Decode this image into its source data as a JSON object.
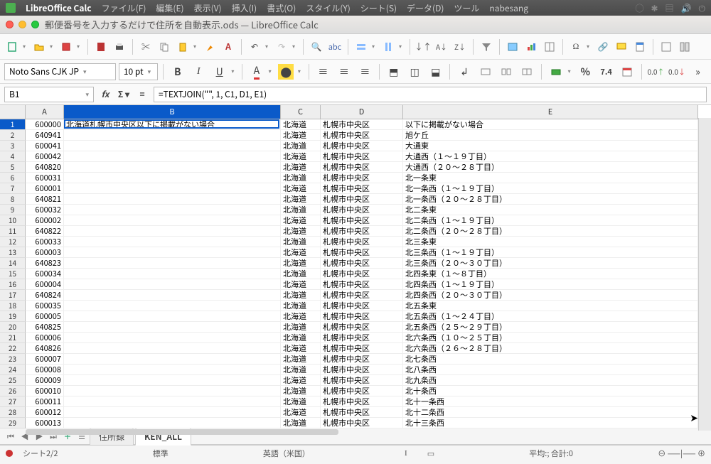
{
  "menubar": {
    "app_name": "LibreOffice Calc",
    "items": [
      "ファイル(F)",
      "編集(E)",
      "表示(V)",
      "挿入(I)",
      "書式(O)",
      "スタイル(Y)",
      "シート(S)",
      "データ(D)",
      "ツール",
      "nabesang"
    ]
  },
  "window": {
    "title": "郵便番号を入力するだけで住所を自動表示.ods — LibreOffice Calc"
  },
  "format": {
    "font": "Noto Sans CJK JP",
    "size": "10 pt"
  },
  "formula": {
    "cellref": "B1",
    "text": "=TEXTJOIN(\"\", 1, C1, D1, E1)"
  },
  "columns": [
    "A",
    "B",
    "C",
    "D",
    "E"
  ],
  "col_widths": {
    "A": 54,
    "B": 305,
    "C": 56,
    "D": 116,
    "E": 415
  },
  "active_cell": "B1",
  "rows": [
    {
      "n": 1,
      "A": "600000",
      "B": "北海道札幌市中央区以下に掲載がない場合",
      "C": "北海道",
      "D": "札幌市中央区",
      "E": "以下に掲載がない場合"
    },
    {
      "n": 2,
      "A": "640941",
      "B": "",
      "C": "北海道",
      "D": "札幌市中央区",
      "E": "旭ケ丘"
    },
    {
      "n": 3,
      "A": "600041",
      "B": "",
      "C": "北海道",
      "D": "札幌市中央区",
      "E": "大通東"
    },
    {
      "n": 4,
      "A": "600042",
      "B": "",
      "C": "北海道",
      "D": "札幌市中央区",
      "E": "大通西（１～１９丁目）"
    },
    {
      "n": 5,
      "A": "640820",
      "B": "",
      "C": "北海道",
      "D": "札幌市中央区",
      "E": "大通西（２０～２８丁目）"
    },
    {
      "n": 6,
      "A": "600031",
      "B": "",
      "C": "北海道",
      "D": "札幌市中央区",
      "E": "北一条東"
    },
    {
      "n": 7,
      "A": "600001",
      "B": "",
      "C": "北海道",
      "D": "札幌市中央区",
      "E": "北一条西（１～１９丁目）"
    },
    {
      "n": 8,
      "A": "640821",
      "B": "",
      "C": "北海道",
      "D": "札幌市中央区",
      "E": "北一条西（２０～２８丁目）"
    },
    {
      "n": 9,
      "A": "600032",
      "B": "",
      "C": "北海道",
      "D": "札幌市中央区",
      "E": "北二条東"
    },
    {
      "n": 10,
      "A": "600002",
      "B": "",
      "C": "北海道",
      "D": "札幌市中央区",
      "E": "北二条西（１～１９丁目）"
    },
    {
      "n": 11,
      "A": "640822",
      "B": "",
      "C": "北海道",
      "D": "札幌市中央区",
      "E": "北二条西（２０～２８丁目）"
    },
    {
      "n": 12,
      "A": "600033",
      "B": "",
      "C": "北海道",
      "D": "札幌市中央区",
      "E": "北三条東"
    },
    {
      "n": 13,
      "A": "600003",
      "B": "",
      "C": "北海道",
      "D": "札幌市中央区",
      "E": "北三条西（１～１９丁目）"
    },
    {
      "n": 14,
      "A": "640823",
      "B": "",
      "C": "北海道",
      "D": "札幌市中央区",
      "E": "北三条西（２０～３０丁目）"
    },
    {
      "n": 15,
      "A": "600034",
      "B": "",
      "C": "北海道",
      "D": "札幌市中央区",
      "E": "北四条東（１～８丁目）"
    },
    {
      "n": 16,
      "A": "600004",
      "B": "",
      "C": "北海道",
      "D": "札幌市中央区",
      "E": "北四条西（１～１９丁目）"
    },
    {
      "n": 17,
      "A": "640824",
      "B": "",
      "C": "北海道",
      "D": "札幌市中央区",
      "E": "北四条西（２０～３０丁目）"
    },
    {
      "n": 18,
      "A": "600035",
      "B": "",
      "C": "北海道",
      "D": "札幌市中央区",
      "E": "北五条東"
    },
    {
      "n": 19,
      "A": "600005",
      "B": "",
      "C": "北海道",
      "D": "札幌市中央区",
      "E": "北五条西（１～２４丁目）"
    },
    {
      "n": 20,
      "A": "640825",
      "B": "",
      "C": "北海道",
      "D": "札幌市中央区",
      "E": "北五条西（２５～２９丁目）"
    },
    {
      "n": 21,
      "A": "600006",
      "B": "",
      "C": "北海道",
      "D": "札幌市中央区",
      "E": "北六条西（１０～２５丁目）"
    },
    {
      "n": 22,
      "A": "640826",
      "B": "",
      "C": "北海道",
      "D": "札幌市中央区",
      "E": "北六条西（２６～２８丁目）"
    },
    {
      "n": 23,
      "A": "600007",
      "B": "",
      "C": "北海道",
      "D": "札幌市中央区",
      "E": "北七条西"
    },
    {
      "n": 24,
      "A": "600008",
      "B": "",
      "C": "北海道",
      "D": "札幌市中央区",
      "E": "北八条西"
    },
    {
      "n": 25,
      "A": "600009",
      "B": "",
      "C": "北海道",
      "D": "札幌市中央区",
      "E": "北九条西"
    },
    {
      "n": 26,
      "A": "600010",
      "B": "",
      "C": "北海道",
      "D": "札幌市中央区",
      "E": "北十条西"
    },
    {
      "n": 27,
      "A": "600011",
      "B": "",
      "C": "北海道",
      "D": "札幌市中央区",
      "E": "北十一条西"
    },
    {
      "n": 28,
      "A": "600012",
      "B": "",
      "C": "北海道",
      "D": "札幌市中央区",
      "E": "北十二条西"
    },
    {
      "n": 29,
      "A": "600013",
      "B": "",
      "C": "北海道",
      "D": "札幌市中央区",
      "E": "北十三条西"
    }
  ],
  "tabs": {
    "items": [
      "住所録",
      "KEN_ALL"
    ],
    "active": 1
  },
  "status": {
    "sheet": "シート2/2",
    "style": "標準",
    "lang": "英語（米国）",
    "stat": "平均:; 合計:0"
  }
}
